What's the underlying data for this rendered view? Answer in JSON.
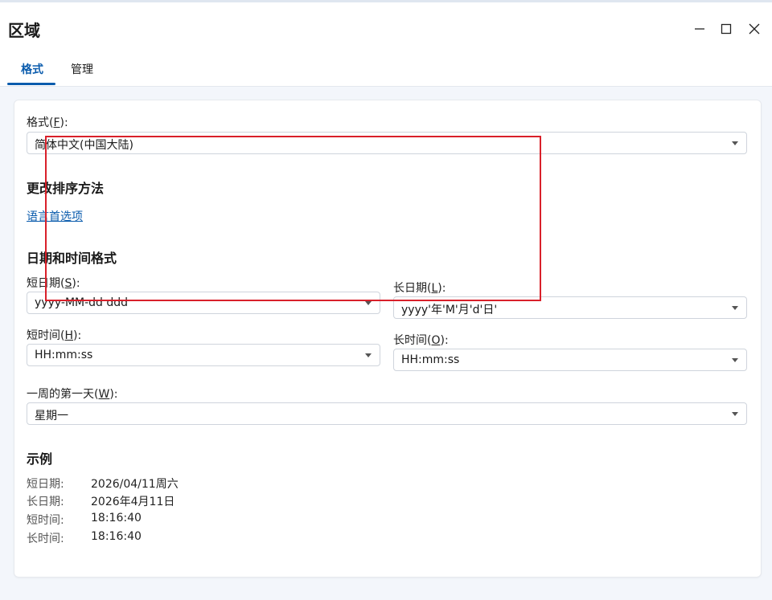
{
  "window": {
    "title": "区域",
    "minimize_icon": "minimize-icon",
    "maximize_icon": "maximize-icon",
    "close_icon": "close-icon"
  },
  "tabs": [
    {
      "label": "格式",
      "active": true
    },
    {
      "label": "管理",
      "active": false
    }
  ],
  "format": {
    "label_prefix": "格式(",
    "label_key": "F",
    "label_suffix": "):",
    "value": "简体中文(中国大陆)"
  },
  "sort": {
    "title": "更改排序方法",
    "link": "语言首选项"
  },
  "datetime": {
    "title": "日期和时间格式",
    "short_date": {
      "prefix": "短日期(",
      "key": "S",
      "suffix": "):",
      "value": "yyyy-MM-dd ddd"
    },
    "long_date": {
      "prefix": "长日期(",
      "key": "L",
      "suffix": "):",
      "value": "yyyy'年'M'月'd'日'"
    },
    "short_time": {
      "prefix": "短时间(",
      "key": "H",
      "suffix": "):",
      "value": "HH:mm:ss"
    },
    "long_time": {
      "prefix": "长时间(",
      "key": "O",
      "suffix": "):",
      "value": "HH:mm:ss"
    },
    "first_day": {
      "prefix": "一周的第一天(",
      "key": "W",
      "suffix": "):",
      "value": "星期一"
    }
  },
  "examples": {
    "title": "示例",
    "rows": [
      {
        "key": "短日期:",
        "value": "2026/04/11周六"
      },
      {
        "key": "长日期:",
        "value": "2026年4月11日"
      },
      {
        "key": "短时间:",
        "value": "18:16:40"
      },
      {
        "key": "长时间:",
        "value": "18:16:40"
      }
    ]
  },
  "colors": {
    "accent": "#0b5cad",
    "highlight": "#d9202a"
  }
}
